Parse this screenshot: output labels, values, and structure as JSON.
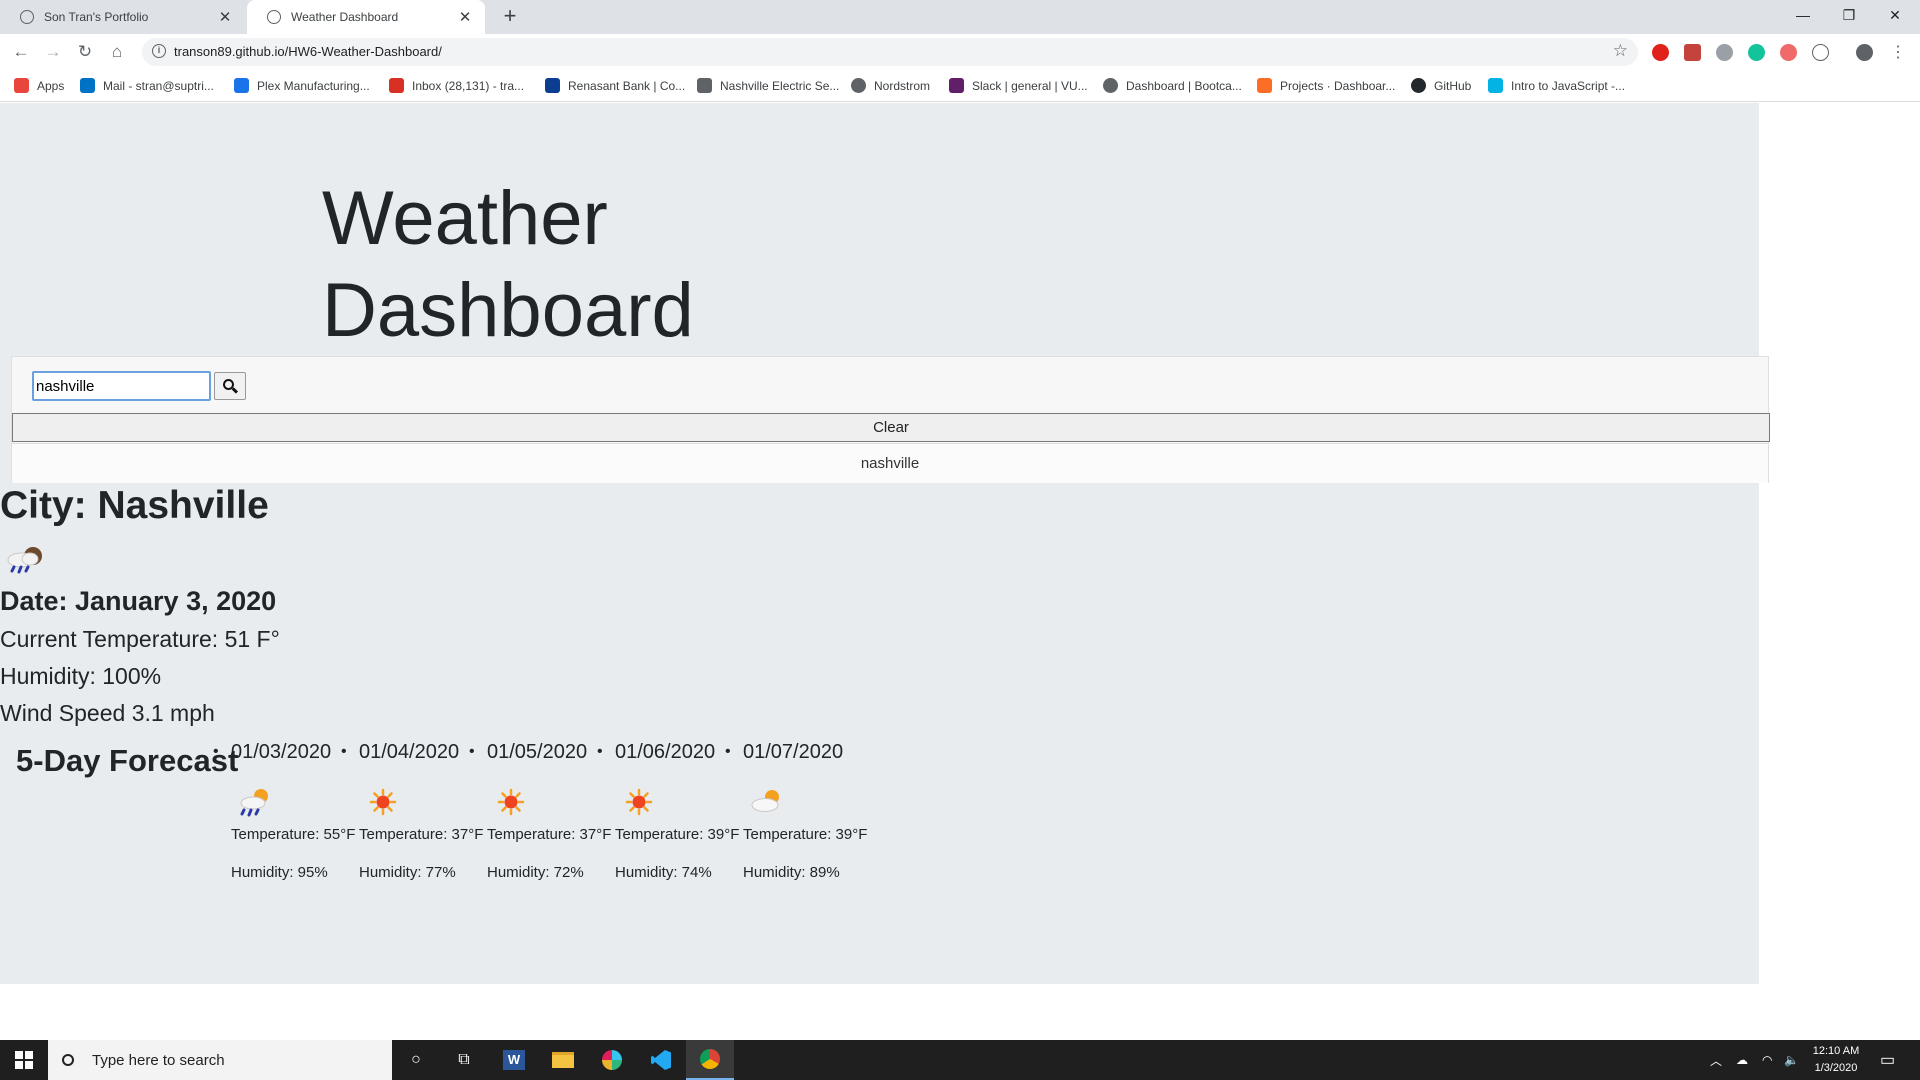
{
  "browser": {
    "tabs": [
      {
        "title": "Son Tran's Portfolio"
      },
      {
        "title": "Weather Dashboard"
      }
    ],
    "url": "transon89.github.io/HW6-Weather-Dashboard/",
    "bookmarks": [
      {
        "label": "Apps",
        "color": "#e8453c"
      },
      {
        "label": "Mail - stran@suptri...",
        "color": "#0072c6"
      },
      {
        "label": "Plex Manufacturing...",
        "color": "#1a73e8"
      },
      {
        "label": "Inbox (28,131) - tra...",
        "color": "#d93025"
      },
      {
        "label": "Renasant Bank | Co...",
        "color": "#0b3d91"
      },
      {
        "label": "Nashville Electric Se...",
        "color": "#5f6368"
      },
      {
        "label": "Nordstrom",
        "color": "#5f6368"
      },
      {
        "label": "Slack | general | VU...",
        "color": "#611f69"
      },
      {
        "label": "Dashboard | Bootca...",
        "color": "#5f6368"
      },
      {
        "label": "Projects · Dashboar...",
        "color": "#fc6d26"
      },
      {
        "label": "GitHub",
        "color": "#24292e"
      },
      {
        "label": "Intro to JavaScript -...",
        "color": "#02b3e4"
      }
    ]
  },
  "page": {
    "title_line1": "Weather",
    "title_line2": "Dashboard",
    "search": {
      "value": "nashville"
    },
    "clear_label": "Clear",
    "history": [
      "nashville"
    ],
    "current": {
      "city": "City: Nashville",
      "icon": "rain-cloud-icon",
      "date": "Date: January 3, 2020",
      "temperature": "Current Temperature: 51 F°",
      "humidity": "Humidity: 100%",
      "wind": "Wind Speed 3.1 mph"
    },
    "forecast_title": "5-Day Forecast",
    "forecast": [
      {
        "date": "01/03/2020",
        "icon": "rain-sun-icon",
        "temp": "Temperature: 55°F",
        "humidity": "Humidity: 95%"
      },
      {
        "date": "01/04/2020",
        "icon": "sun-icon",
        "temp": "Temperature: 37°F",
        "humidity": "Humidity: 77%"
      },
      {
        "date": "01/05/2020",
        "icon": "sun-icon",
        "temp": "Temperature: 37°F",
        "humidity": "Humidity: 72%"
      },
      {
        "date": "01/06/2020",
        "icon": "sun-icon",
        "temp": "Temperature: 39°F",
        "humidity": "Humidity: 74%"
      },
      {
        "date": "01/07/2020",
        "icon": "cloud-sun-icon",
        "temp": "Temperature: 39°F",
        "humidity": "Humidity: 89%"
      }
    ]
  },
  "taskbar": {
    "search_placeholder": "Type here to search",
    "time": "12:10 AM",
    "date": "1/3/2020"
  },
  "colors": {
    "jumbotron": "#e9ecef",
    "sun": "#f4a020",
    "rain": "#2c3aa8",
    "focus_outline": "#6aa0e0"
  }
}
